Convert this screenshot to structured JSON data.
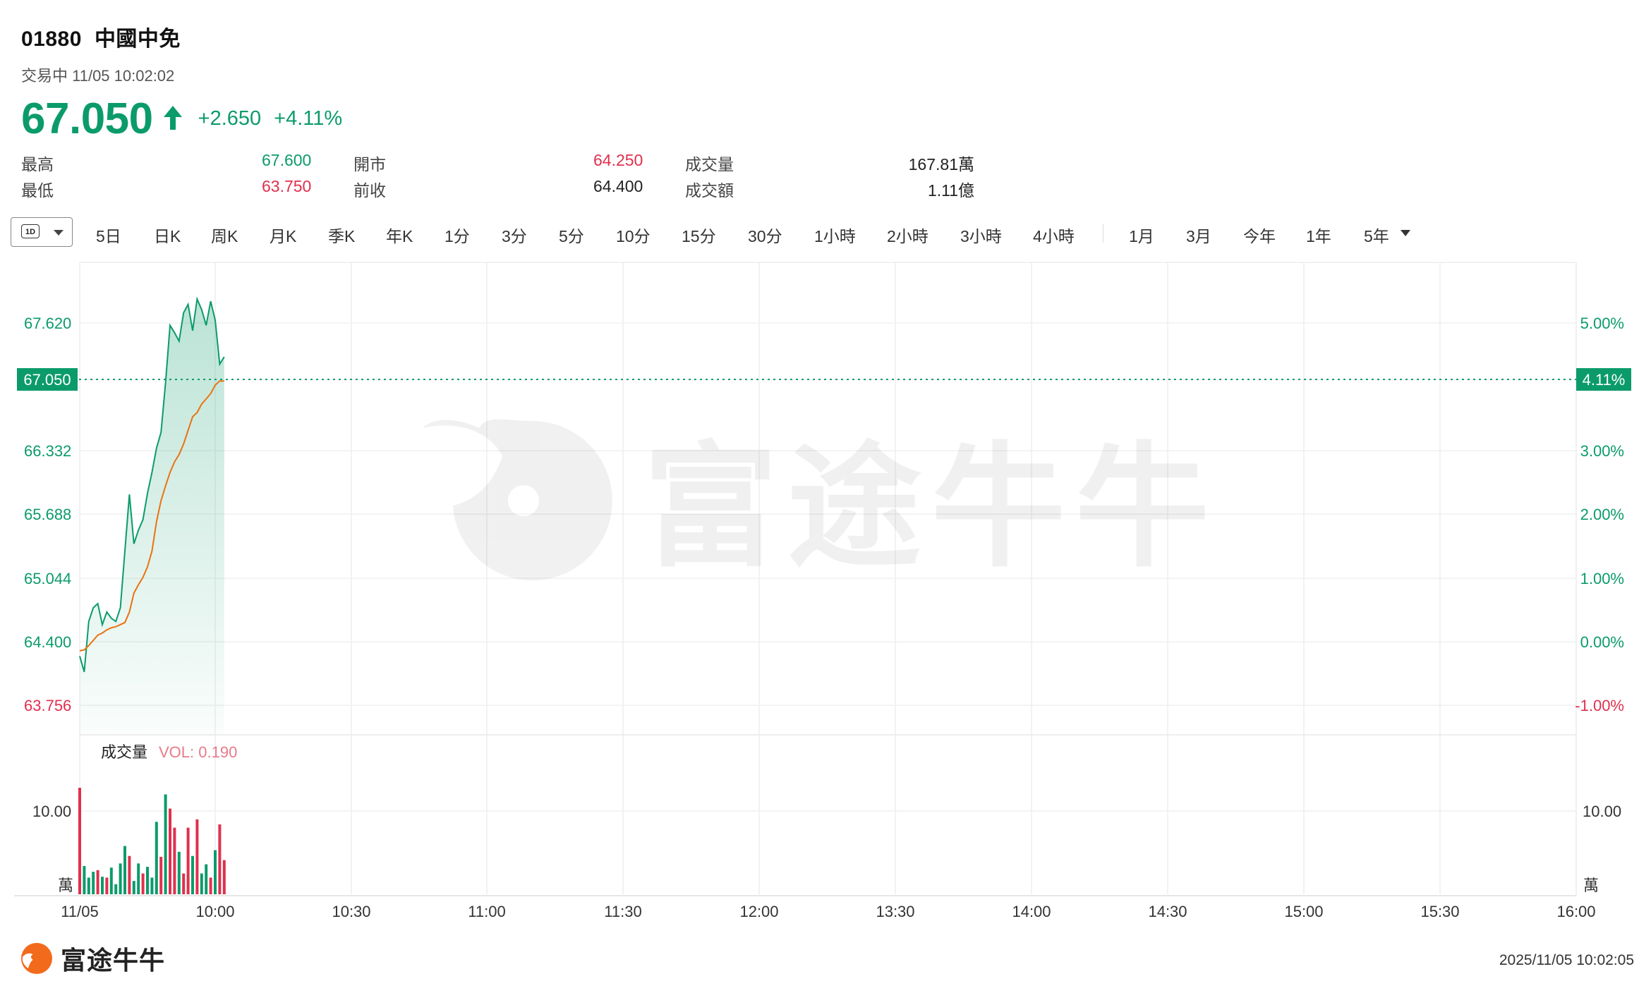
{
  "stock": {
    "code": "01880",
    "name": "中國中免"
  },
  "status": "交易中 11/05 10:02:02",
  "quote": {
    "price": "67.050",
    "change": "+2.650",
    "change_pct": "+4.11%"
  },
  "stats": {
    "high_label": "最高",
    "high": "67.600",
    "low_label": "最低",
    "low": "63.750",
    "open_label": "開市",
    "open": "64.250",
    "prev_close_label": "前收",
    "prev_close": "64.400",
    "volume_label": "成交量",
    "volume": "167.81萬",
    "turnover_label": "成交額",
    "turnover": "1.11億"
  },
  "toolbar": {
    "period_dropdown": "1D",
    "tabs": [
      "5日",
      "日K",
      "周K",
      "月K",
      "季K",
      "年K",
      "1分",
      "3分",
      "5分",
      "10分",
      "15分",
      "30分",
      "1小時",
      "2小時",
      "3小時",
      "4小時"
    ],
    "range_tabs": [
      "1月",
      "3月",
      "今年",
      "1年",
      "5年"
    ]
  },
  "chart_data": {
    "type": "line",
    "title": "",
    "price_axis": [
      "67.620",
      "66.332",
      "65.688",
      "65.044",
      "64.400",
      "63.756"
    ],
    "pct_axis": [
      "5.00%",
      "3.00%",
      "2.00%",
      "1.00%",
      "0.00%",
      "-1.00%"
    ],
    "current_price_label": "67.050",
    "current_pct_label": "4.11%",
    "x_ticks": [
      "11/05",
      "10:00",
      "10:30",
      "11:00",
      "11:30",
      "12:00",
      "13:30",
      "14:00",
      "14:30",
      "15:00",
      "15:30",
      "16:00"
    ],
    "prev_close": 64.4,
    "ylim": [
      63.45,
      67.95
    ],
    "series": [
      {
        "name": "",
        "x": [
          0,
          1,
          2,
          3,
          4,
          5,
          6,
          7,
          8,
          9,
          10,
          11,
          12,
          13,
          14,
          15,
          16,
          17,
          18,
          19,
          20,
          21,
          22,
          23,
          24,
          25,
          26,
          27,
          28,
          29,
          30,
          31,
          32
        ],
        "values": [
          64.2,
          64.05,
          64.53,
          64.66,
          64.7,
          64.5,
          64.62,
          64.56,
          64.53,
          64.66,
          65.2,
          65.74,
          65.27,
          65.4,
          65.5,
          65.75,
          65.95,
          66.18,
          66.33,
          66.8,
          67.35,
          67.28,
          67.2,
          67.47,
          67.55,
          67.3,
          67.6,
          67.5,
          67.35,
          67.58,
          67.4,
          66.98,
          67.05
        ],
        "color": "#0b9b6b"
      },
      {
        "name": "",
        "x": [
          0,
          1,
          2,
          3,
          4,
          5,
          6,
          7,
          8,
          9,
          10,
          11,
          12,
          13,
          14,
          15,
          16,
          17,
          18,
          19,
          20,
          21,
          22,
          23,
          24,
          25,
          26,
          27,
          28,
          29,
          30,
          31,
          32
        ],
        "values": [
          64.25,
          64.26,
          64.3,
          64.35,
          64.4,
          64.42,
          64.45,
          64.47,
          64.48,
          64.5,
          64.52,
          64.62,
          64.8,
          64.88,
          64.95,
          65.05,
          65.2,
          65.48,
          65.68,
          65.82,
          65.95,
          66.05,
          66.12,
          66.22,
          66.35,
          66.48,
          66.52,
          66.6,
          66.65,
          66.7,
          66.78,
          66.82,
          66.82
        ],
        "color": "#e9730f"
      }
    ],
    "volume": {
      "title": "成交量",
      "vol_label": "VOL: 0.190",
      "axis_label": "10.00",
      "unit": "萬",
      "ylim": [
        0,
        12
      ],
      "values": [
        12.8,
        3.4,
        2.0,
        2.7,
        2.9,
        2.1,
        2.0,
        3.2,
        1.2,
        3.7,
        5.8,
        4.6,
        1.6,
        3.7,
        2.5,
        3.3,
        2.0,
        8.7,
        4.5,
        12.0,
        10.3,
        8.0,
        5.1,
        2.5,
        8.0,
        4.6,
        9.0,
        2.5,
        3.6,
        2.0,
        5.3,
        8.4,
        4.1
      ],
      "colors": [
        "#e0304e",
        "#0b9b6b",
        "#0b9b6b",
        "#0b9b6b",
        "#e0304e",
        "#0b9b6b",
        "#e0304e",
        "#0b9b6b",
        "#0b9b6b",
        "#0b9b6b",
        "#0b9b6b",
        "#e0304e",
        "#0b9b6b",
        "#0b9b6b",
        "#e0304e",
        "#0b9b6b",
        "#0b9b6b",
        "#0b9b6b",
        "#e0304e",
        "#0b9b6b",
        "#e0304e",
        "#e0304e",
        "#0b9b6b",
        "#e0304e",
        "#e0304e",
        "#0b9b6b",
        "#e0304e",
        "#0b9b6b",
        "#0b9b6b",
        "#e0304e",
        "#0b9b6b",
        "#e0304e",
        "#e0304e"
      ]
    }
  },
  "footer": {
    "brand": "富途牛牛",
    "timestamp": "2025/11/05 10:02:05"
  },
  "watermark": "富途牛牛",
  "colors": {
    "up": "#0b9b6b",
    "down": "#e0304e",
    "avg": "#e9730f"
  }
}
